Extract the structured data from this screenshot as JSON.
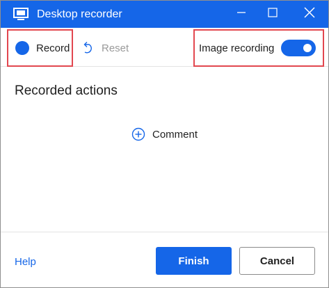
{
  "window": {
    "title": "Desktop recorder",
    "accent_color": "#1566e8",
    "highlight_color": "#e2474f"
  },
  "toolbar": {
    "record_label": "Record",
    "reset_label": "Reset",
    "image_recording_label": "Image recording",
    "image_recording_on": true
  },
  "main": {
    "section_title": "Recorded actions",
    "comment_label": "Comment"
  },
  "footer": {
    "help_label": "Help",
    "finish_label": "Finish",
    "cancel_label": "Cancel"
  },
  "icons": [
    "desktop-recorder-icon",
    "minimize-icon",
    "maximize-icon",
    "close-icon",
    "record-dot-icon",
    "reset-icon",
    "plus-circle-icon"
  ]
}
